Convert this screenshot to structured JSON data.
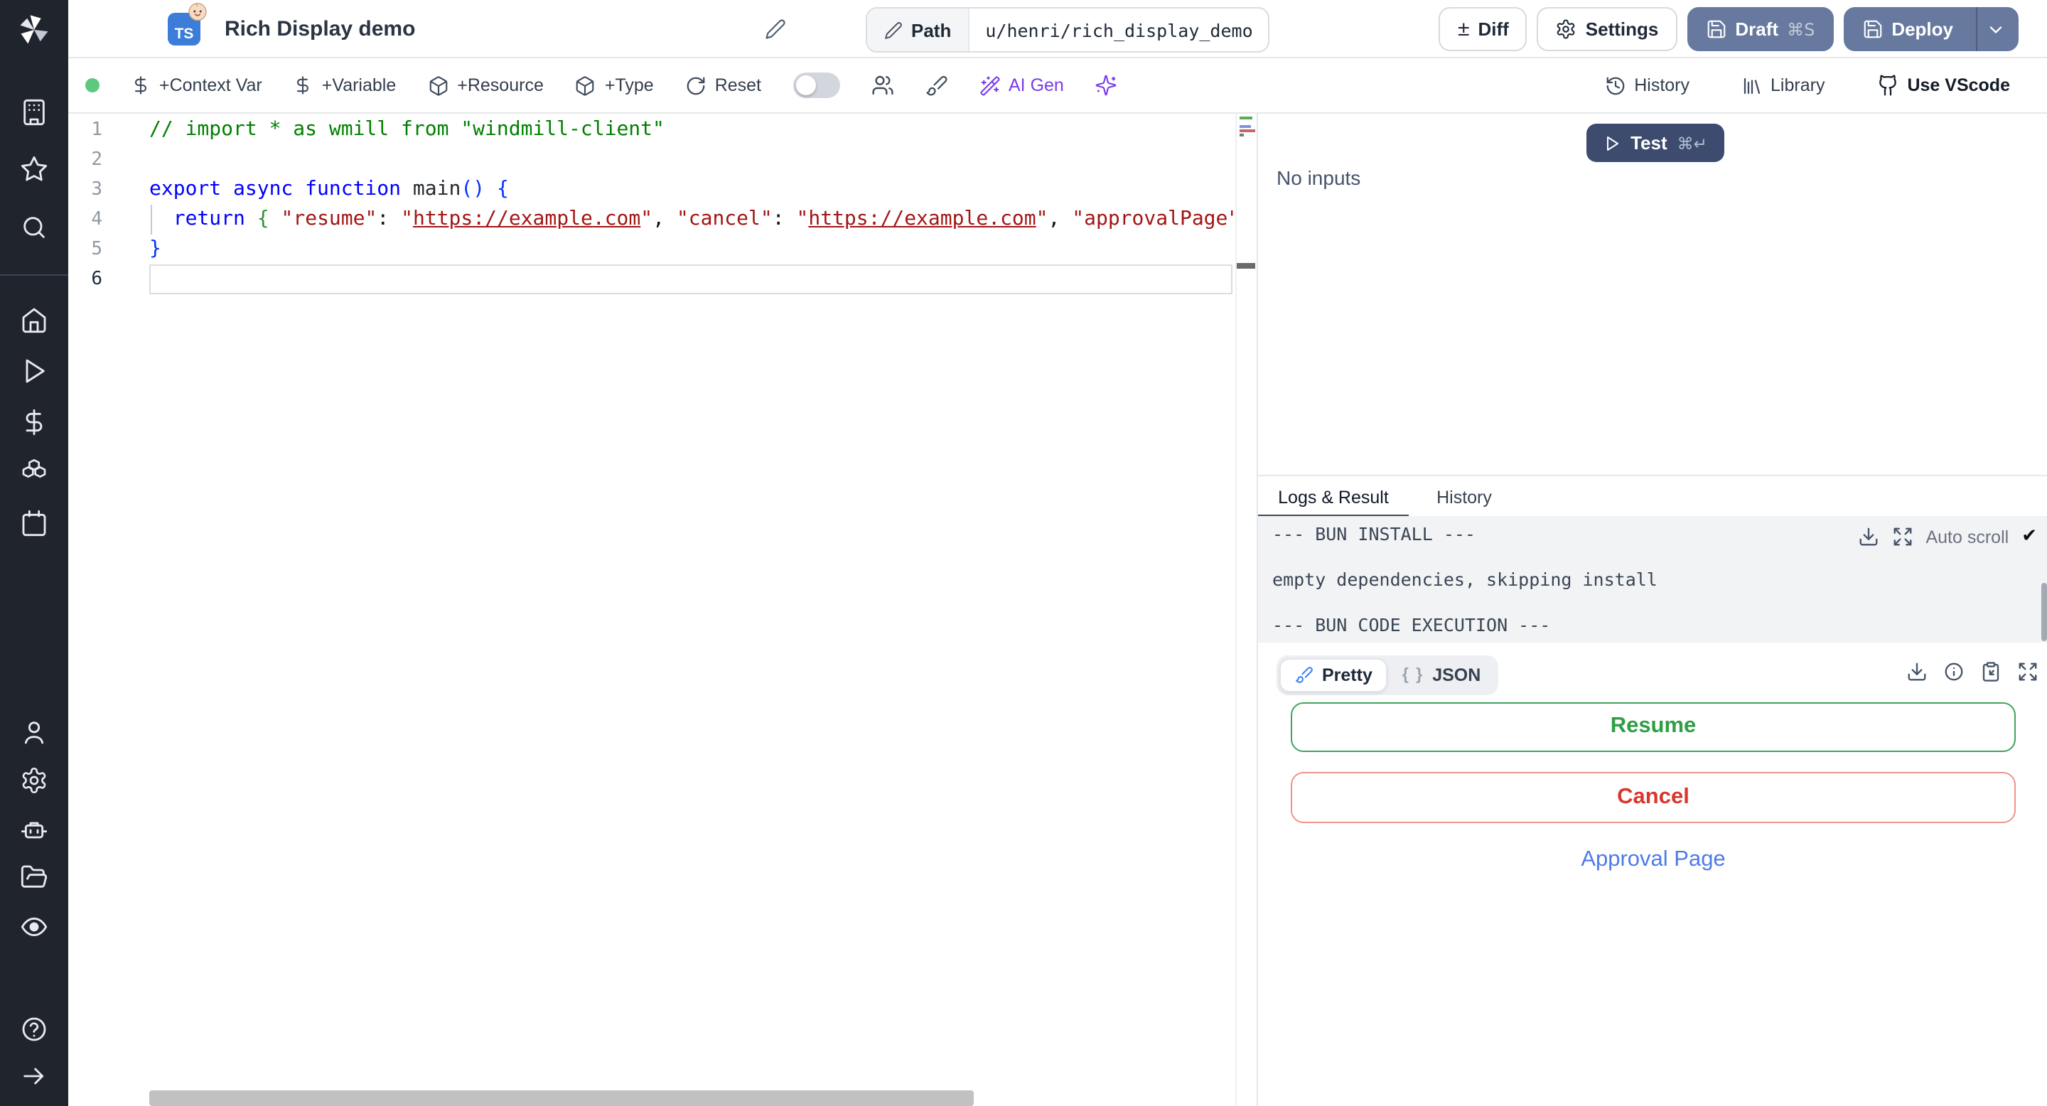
{
  "header": {
    "badge": "TS",
    "title": "Rich Display demo",
    "path_label": "Path",
    "path_value": "u/henri/rich_display_demo",
    "diff_label": "Diff",
    "diff_glyph": "±",
    "settings_label": "Settings",
    "draft_label": "Draft",
    "draft_shortcut": "⌘S",
    "deploy_label": "Deploy"
  },
  "toolbar": {
    "context_var": "+Context Var",
    "variable": "+Variable",
    "resource": "+Resource",
    "type": "+Type",
    "reset": "Reset",
    "ai_gen": "AI Gen",
    "history": "History",
    "library": "Library",
    "vscode": "Use VScode"
  },
  "sidebar": {
    "icons": [
      "windmill-logo",
      "workspace-icon",
      "favorites-icon",
      "search-icon",
      "home-icon",
      "runs-icon",
      "variables-icon",
      "resources-icon",
      "schedules-icon",
      "user-icon",
      "settings-icon",
      "workers-icon",
      "folders-icon",
      "logs-icon",
      "help-icon",
      "expand-sidebar-icon"
    ]
  },
  "editor": {
    "active_line": 6,
    "lines": [
      [
        {
          "t": "// import * as wmill from \"windmill-client\"",
          "c": "cm"
        }
      ],
      [],
      [
        {
          "t": "export async function",
          "c": "kw"
        },
        {
          "t": " ",
          "c": "pl"
        },
        {
          "t": "main",
          "c": "fn"
        },
        {
          "t": "()",
          "c": "br1"
        },
        {
          "t": " ",
          "c": "pl"
        },
        {
          "t": "{",
          "c": "br1"
        }
      ],
      [
        {
          "t": "  ",
          "c": "pl"
        },
        {
          "t": "return",
          "c": "kw"
        },
        {
          "t": " ",
          "c": "pl"
        },
        {
          "t": "{",
          "c": "br2"
        },
        {
          "t": " ",
          "c": "pl"
        },
        {
          "t": "\"resume\"",
          "c": "str"
        },
        {
          "t": ": ",
          "c": "pl"
        },
        {
          "t": "\"",
          "c": "str"
        },
        {
          "t": "https://example.com",
          "c": "strlink"
        },
        {
          "t": "\"",
          "c": "str"
        },
        {
          "t": ", ",
          "c": "pl"
        },
        {
          "t": "\"cancel\"",
          "c": "str"
        },
        {
          "t": ": ",
          "c": "pl"
        },
        {
          "t": "\"",
          "c": "str"
        },
        {
          "t": "https://example.com",
          "c": "strlink"
        },
        {
          "t": "\"",
          "c": "str"
        },
        {
          "t": ", ",
          "c": "pl"
        },
        {
          "t": "\"approvalPage\"",
          "c": "str"
        },
        {
          "t": ":",
          "c": "pl"
        }
      ],
      [
        {
          "t": "}",
          "c": "br1"
        }
      ],
      []
    ]
  },
  "run_panel": {
    "test_label": "Test",
    "test_shortcut": "⌘↵",
    "no_inputs": "No inputs",
    "tabs": {
      "logs_result": "Logs & Result",
      "history": "History"
    },
    "log_lines": [
      "--- BUN INSTALL ---",
      "",
      "empty dependencies, skipping install",
      "",
      "--- BUN CODE EXECUTION ---"
    ],
    "auto_scroll": "Auto scroll",
    "check_glyph": "✔",
    "result_toggle": {
      "pretty": "Pretty",
      "braces": "{ }",
      "json": "JSON"
    },
    "result": {
      "resume": "Resume",
      "cancel": "Cancel",
      "approval": "Approval Page"
    }
  },
  "colors": {
    "ts_blue": "#3b7dd8",
    "status_green": "#5ec87f",
    "ai_violet": "#7a3bec",
    "button_slate": "#67799f",
    "test_navy": "#3d4b6e",
    "resume_green": "#2f9e44",
    "cancel_red": "#d6382c",
    "link_blue": "#4e7ae8"
  }
}
